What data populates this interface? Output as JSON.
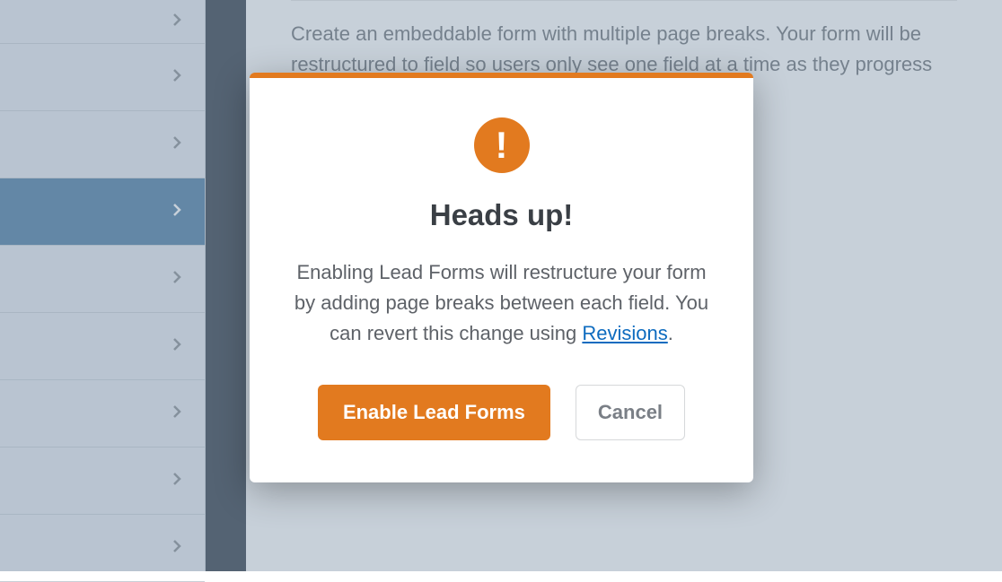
{
  "main": {
    "description": "Create an embeddable form with multiple page breaks. Your form will be restructured to field so users only see one field at a time as they progress through the form. You can p"
  },
  "modal": {
    "title": "Heads up!",
    "body_pre": "Enabling Lead Forms will restructure your form by adding page breaks between each field. You can revert this change using ",
    "link": "Revisions",
    "body_post": ".",
    "enable": "Enable Lead Forms",
    "cancel": "Cancel"
  }
}
